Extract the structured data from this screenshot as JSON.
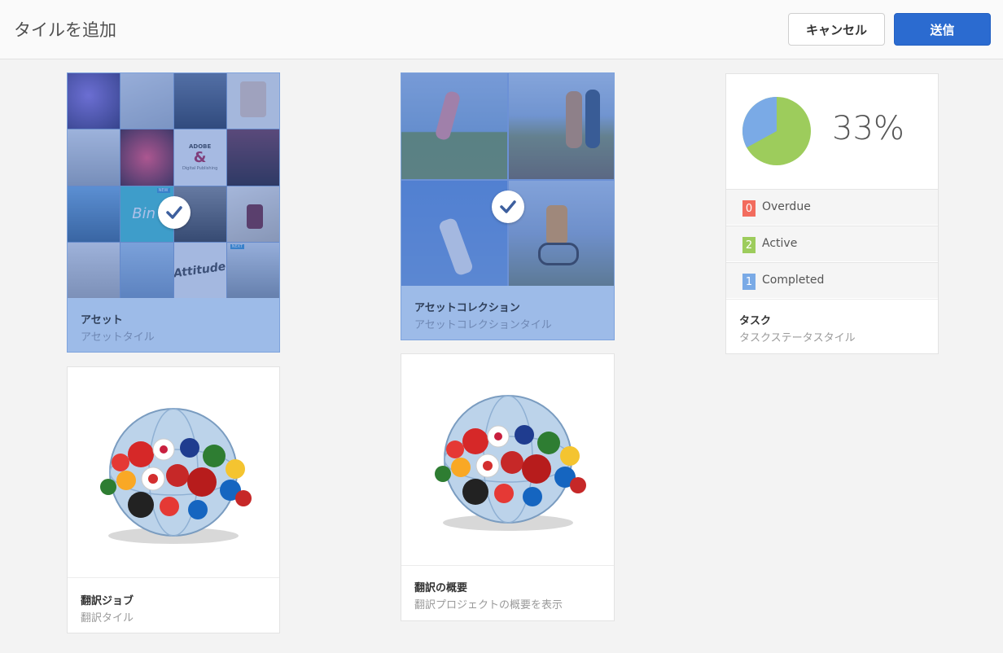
{
  "header": {
    "title": "タイルを追加",
    "cancel_label": "キャンセル",
    "submit_label": "送信"
  },
  "tiles": {
    "asset": {
      "title": "アセット",
      "subtitle": "アセットタイル"
    },
    "asset_collection": {
      "title": "アセットコレクション",
      "subtitle": "アセットコレクションタイル"
    },
    "task": {
      "title": "タスク",
      "subtitle": "タスクステータスタイル",
      "percent": "33%",
      "rows": [
        {
          "count": "0",
          "label": "Overdue",
          "color": "#f26c5e"
        },
        {
          "count": "2",
          "label": "Active",
          "color": "#9dcc5c"
        },
        {
          "count": "1",
          "label": "Completed",
          "color": "#7aaae6"
        }
      ]
    },
    "translation_job": {
      "title": "翻訳ジョブ",
      "subtitle": "翻訳タイル"
    },
    "translation_summary": {
      "title": "翻訳の概要",
      "subtitle": "翻訳プロジェクトの概要を表示"
    }
  },
  "asset_thumb_texts": {
    "adobe": "ADOBE",
    "digital_publishing": "Digital Publishing",
    "new1": "NEW",
    "bin": "Bin",
    "attitude": "Attitude",
    "new2": "NEXT"
  },
  "colors": {
    "accent": "#2b6bd0",
    "selected_tile": "#9dbbe8",
    "pie_active": "#9dcc5c",
    "pie_completed": "#7aaae6"
  }
}
